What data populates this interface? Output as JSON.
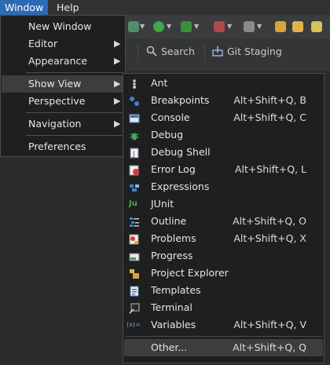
{
  "menubar": {
    "window": "Window",
    "help": "Help"
  },
  "toolbar": {
    "search": "Search",
    "git_staging": "Git Staging"
  },
  "window_menu": {
    "new_window": "New Window",
    "editor": "Editor",
    "appearance": "Appearance",
    "show_view": "Show View",
    "perspective": "Perspective",
    "navigation": "Navigation",
    "preferences": "Preferences"
  },
  "show_view": [
    {
      "label": "Ant",
      "shortcut": ""
    },
    {
      "label": "Breakpoints",
      "shortcut": "Alt+Shift+Q, B"
    },
    {
      "label": "Console",
      "shortcut": "Alt+Shift+Q, C"
    },
    {
      "label": "Debug",
      "shortcut": ""
    },
    {
      "label": "Debug Shell",
      "shortcut": ""
    },
    {
      "label": "Error Log",
      "shortcut": "Alt+Shift+Q, L"
    },
    {
      "label": "Expressions",
      "shortcut": ""
    },
    {
      "label": "JUnit",
      "shortcut": ""
    },
    {
      "label": "Outline",
      "shortcut": "Alt+Shift+Q, O"
    },
    {
      "label": "Problems",
      "shortcut": "Alt+Shift+Q, X"
    },
    {
      "label": "Progress",
      "shortcut": ""
    },
    {
      "label": "Project Explorer",
      "shortcut": ""
    },
    {
      "label": "Templates",
      "shortcut": ""
    },
    {
      "label": "Terminal",
      "shortcut": ""
    },
    {
      "label": "Variables",
      "shortcut": "Alt+Shift+Q, V"
    },
    {
      "label": "Other...",
      "shortcut": "Alt+Shift+Q, Q"
    }
  ],
  "icons": {
    "arrow": "▶",
    "junit": "Ju",
    "variables": "(x)="
  },
  "colors": {
    "highlight": "#3b3d3f",
    "menubar_active": "#2c6ab4"
  }
}
